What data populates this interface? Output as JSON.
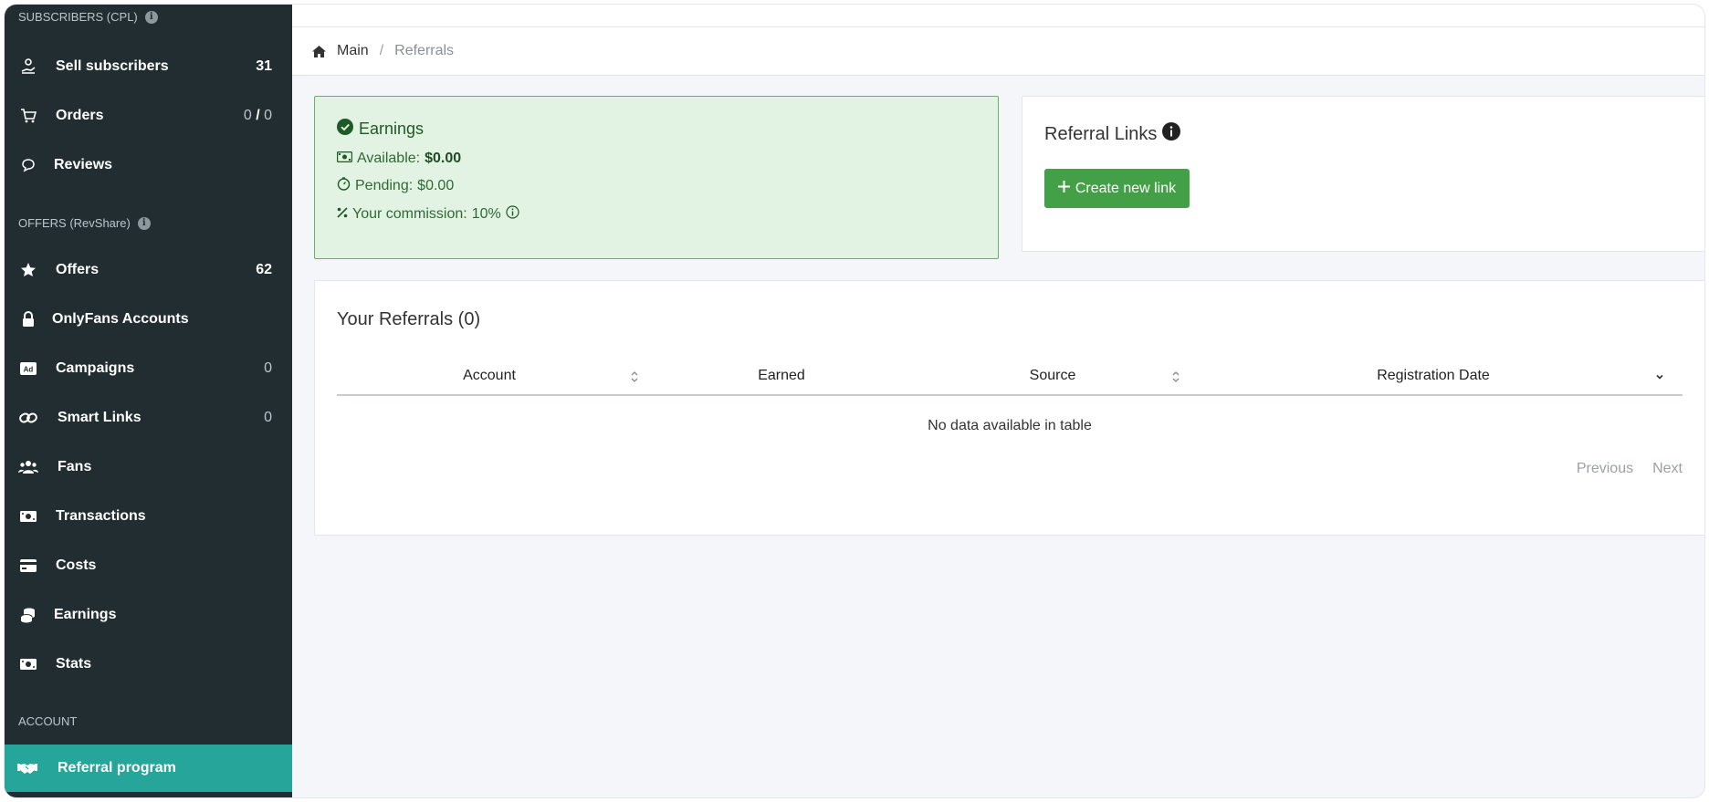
{
  "sidebar": {
    "section_subscribers": "SUBSCRIBERS (CPL)",
    "section_offers": "OFFERS (RevShare)",
    "section_account": "ACCOUNT",
    "items": [
      {
        "label": "Sell subscribers",
        "count": "31",
        "icon": "hand-coin-icon"
      },
      {
        "label": "Orders",
        "count_a": "0",
        "count_sep": "/",
        "count_b": "0",
        "icon": "cart-icon"
      },
      {
        "label": "Reviews",
        "icon": "comment-icon"
      },
      {
        "label": "Offers",
        "count": "62",
        "icon": "star-icon"
      },
      {
        "label": "OnlyFans Accounts",
        "icon": "lock-icon"
      },
      {
        "label": "Campaigns",
        "count": "0",
        "icon": "ad-icon"
      },
      {
        "label": "Smart Links",
        "count": "0",
        "icon": "link-icon"
      },
      {
        "label": "Fans",
        "icon": "users-icon"
      },
      {
        "label": "Transactions",
        "icon": "money-bill-icon"
      },
      {
        "label": "Costs",
        "icon": "credit-card-icon"
      },
      {
        "label": "Earnings",
        "icon": "coins-icon"
      },
      {
        "label": "Stats",
        "icon": "money-bill-icon"
      },
      {
        "label": "Referral program",
        "icon": "handshake-icon",
        "active": true
      }
    ],
    "active_color": "#26a69a"
  },
  "breadcrumb": {
    "home": "Main",
    "separator": "/",
    "current": "Referrals"
  },
  "earnings": {
    "title": "Earnings",
    "available_label": "Available:",
    "available_value": "$0.00",
    "pending_label": "Pending:",
    "pending_value": "$0.00",
    "commission_label": "Your commission:",
    "commission_value": "10%"
  },
  "referral_links": {
    "title": "Referral Links",
    "create_button": "Create new link"
  },
  "referrals_table": {
    "title": "Your Referrals (0)",
    "columns": [
      "Account",
      "Earned",
      "Source",
      "Registration Date"
    ],
    "empty_message": "No data available in table",
    "previous": "Previous",
    "next": "Next"
  },
  "colors": {
    "sidebar_bg": "#222d32",
    "success_bg": "#e2f2e3",
    "success_border": "#5fb466",
    "button_green": "#43a047"
  }
}
